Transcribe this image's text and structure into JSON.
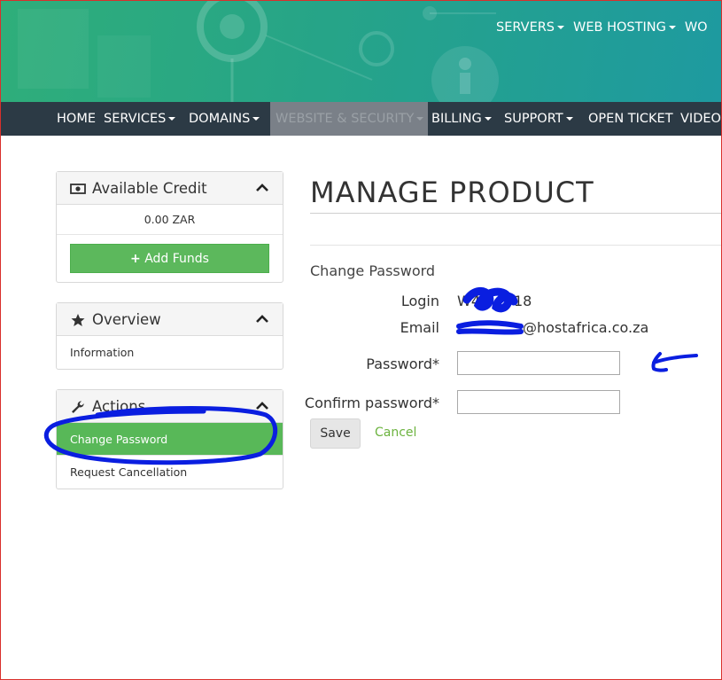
{
  "top_nav": [
    {
      "label": "SERVERS",
      "has_caret": true
    },
    {
      "label": "WEB HOSTING",
      "has_caret": true
    },
    {
      "label": "WO",
      "has_caret": false
    }
  ],
  "main_nav": [
    {
      "label": "HOME",
      "has_caret": false
    },
    {
      "label": "SERVICES",
      "has_caret": true
    },
    {
      "label": "DOMAINS",
      "has_caret": true
    },
    {
      "label": "WEBSITE & SECURITY",
      "has_caret": true,
      "active": true
    },
    {
      "label": "BILLING",
      "has_caret": true
    },
    {
      "label": "SUPPORT",
      "has_caret": true
    },
    {
      "label": "OPEN TICKET",
      "has_caret": false
    },
    {
      "label": "VIDEO",
      "has_caret": false
    }
  ],
  "sidebar": {
    "credit": {
      "title": "Available Credit",
      "icon": "money-icon",
      "value": "0.00 ZAR",
      "add_funds": "Add Funds"
    },
    "overview": {
      "title": "Overview",
      "icon": "star-icon",
      "items": [
        "Information"
      ]
    },
    "actions": {
      "title": "Actions",
      "icon": "wrench-icon",
      "items": [
        "Change Password",
        "Request Cancellation"
      ],
      "active_item": "Change Password"
    }
  },
  "main": {
    "title": "MANAGE PRODUCT",
    "section": "Change Password",
    "login_label": "Login",
    "login_value": "W4",
    "login_value_end": "18",
    "email_label": "Email",
    "email_value": "@hostafrica.co.za",
    "password_label": "Password*",
    "confirm_label": "Confirm password*",
    "password_value": "",
    "confirm_value": "",
    "save": "Save",
    "cancel": "Cancel"
  },
  "colors": {
    "accent_green": "#5cb85c",
    "nav_dark": "#2c3a45",
    "scribble_blue": "#0a1ee0",
    "cancel_green": "#6cb33f"
  }
}
